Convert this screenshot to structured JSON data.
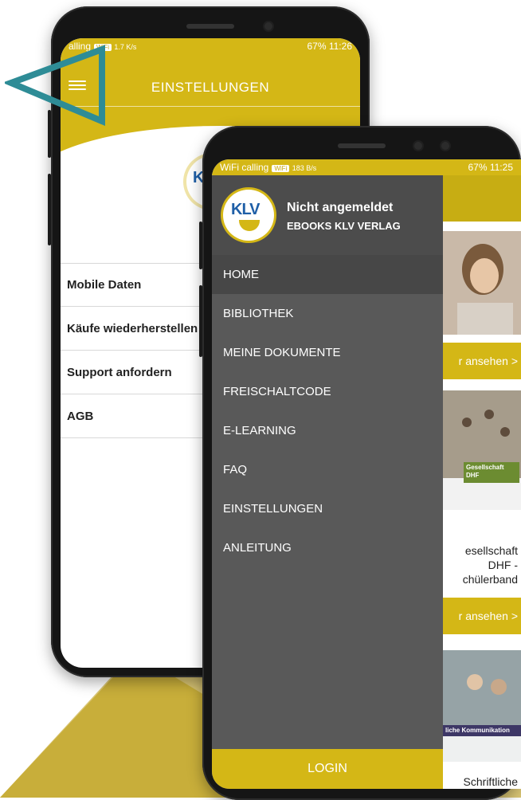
{
  "colors": {
    "accent": "#d4b716",
    "drawer": "#595959",
    "drawer_active": "#474747",
    "arrow": "#2e8c96"
  },
  "back_phone": {
    "status_left": "alling",
    "status_chip": "WiFi",
    "status_speed": "1.7 K/s",
    "status_right": "67% 11:26",
    "title": "EINSTELLUNGEN",
    "logo_text": "KL",
    "settings": [
      {
        "label": "Mobile Daten"
      },
      {
        "label": "Käufe wiederherstellen"
      },
      {
        "label": "Support anfordern"
      },
      {
        "label": "AGB"
      }
    ]
  },
  "front_phone": {
    "status_left": "WiFi calling",
    "status_chip": "WiFi",
    "status_speed": "183 B/s",
    "status_right": "67% 11:25",
    "user_name": "Nicht angemeldet",
    "user_subtitle": "EBOOKS KLV VERLAG",
    "logo_text": "KLV",
    "menu": [
      {
        "label": "HOME",
        "active": true
      },
      {
        "label": "BIBLIOTHEK"
      },
      {
        "label": "MEINE DOKUMENTE"
      },
      {
        "label": "FREISCHALTCODE"
      },
      {
        "label": "E-LEARNING"
      },
      {
        "label": "FAQ"
      },
      {
        "label": "EINSTELLUNGEN"
      },
      {
        "label": "ANLEITUNG"
      }
    ],
    "login_label": "LOGIN",
    "content": {
      "ansehen_1": "r ansehen >",
      "tag_1": "Gesellschaft DHF",
      "book_title_1": "esellschaft DHF - chülerband",
      "ansehen_2": "r ansehen >",
      "tag_2": "liche Kommunikation",
      "book_title_2": "Schriftliche"
    }
  },
  "icons": {
    "menu": "hamburger-icon",
    "arrow": "triangle-arrow-icon"
  }
}
